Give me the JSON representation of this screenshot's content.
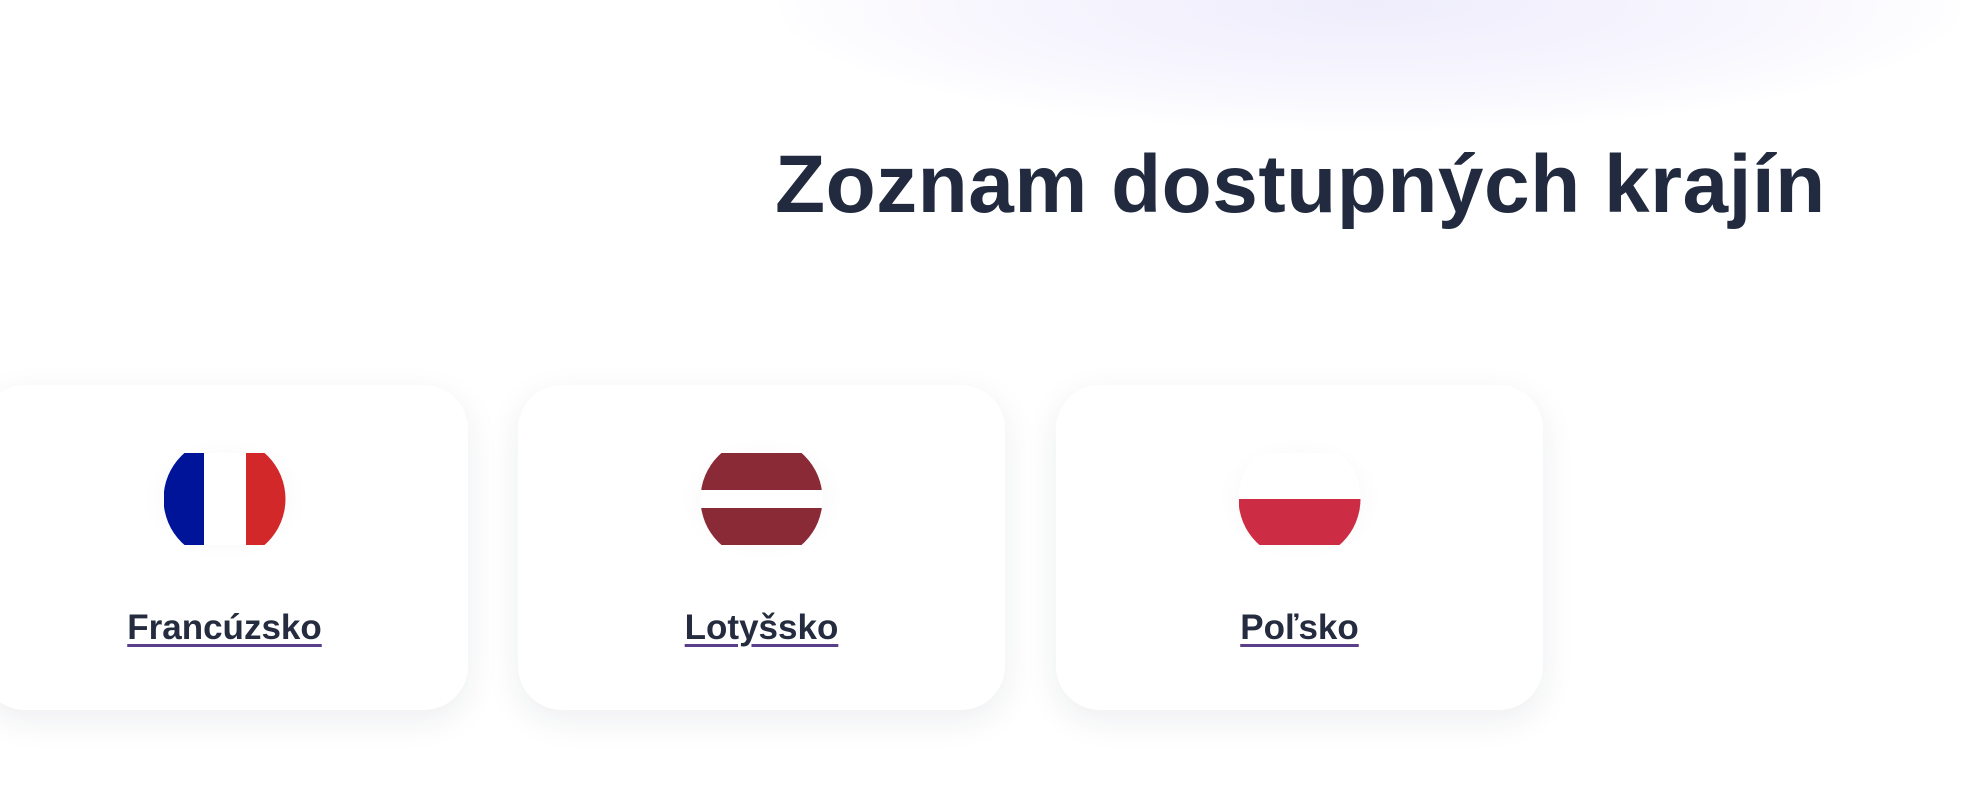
{
  "page": {
    "title": "Zoznam dostupných krajín"
  },
  "countries": [
    {
      "name": "Francúzsko",
      "flag_icon": "france-flag-icon",
      "flag_colors": [
        "#00149a",
        "#ffffff",
        "#d3282a"
      ]
    },
    {
      "name": "Lotyšsko",
      "flag_icon": "latvia-flag-icon",
      "flag_colors": [
        "#8a2a37",
        "#ffffff",
        "#8a2a37"
      ]
    },
    {
      "name": "Poľsko",
      "flag_icon": "poland-flag-icon",
      "flag_colors": [
        "#ffffff",
        "#cc2d45"
      ]
    }
  ]
}
